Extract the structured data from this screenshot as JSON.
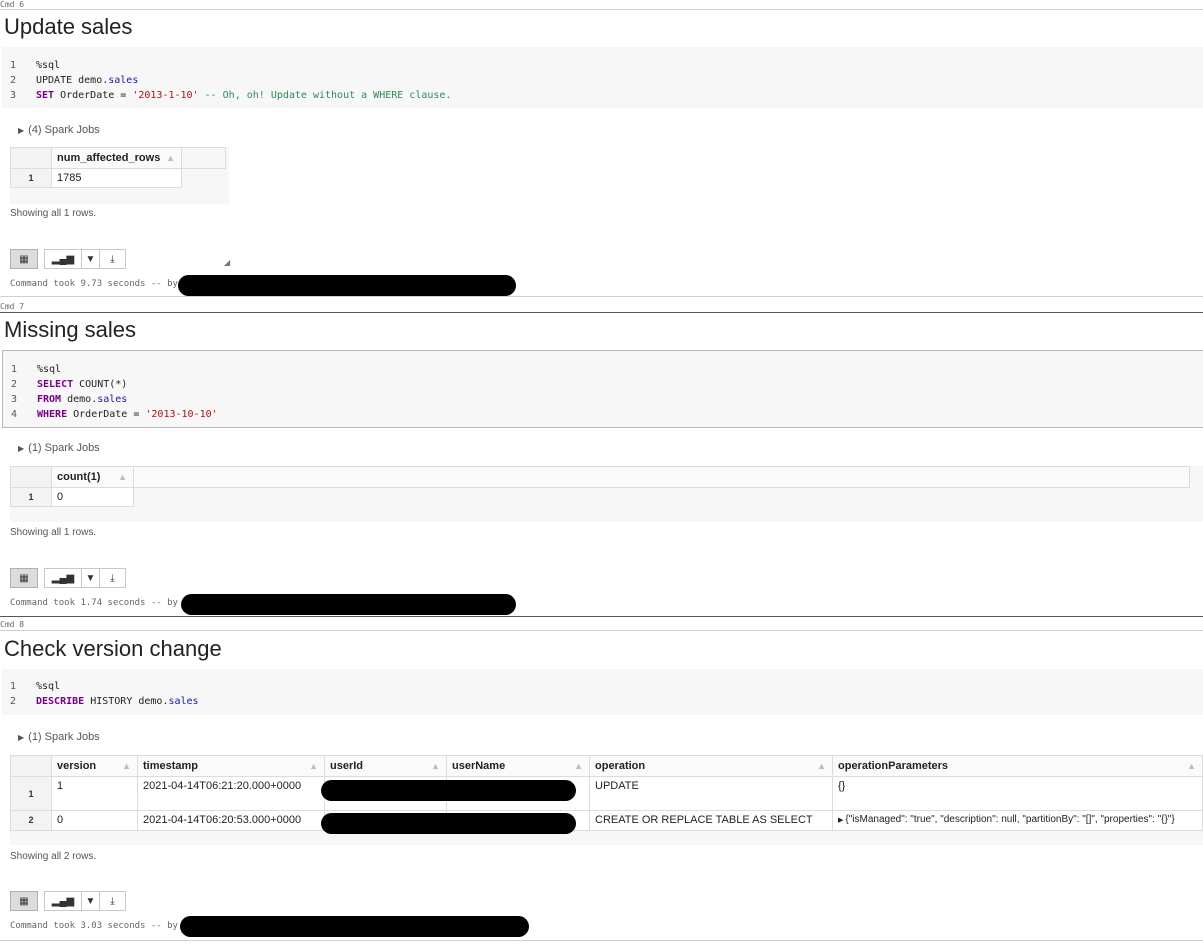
{
  "cells": [
    {
      "cmd": "Cmd 6",
      "title": "Update sales",
      "code": [
        {
          "n": "1",
          "tokens": [
            {
              "t": "%sql",
              "c": ""
            }
          ]
        },
        {
          "n": "2",
          "tokens": [
            {
              "t": "UPDATE demo.",
              "c": ""
            },
            {
              "t": "sales",
              "c": "tb"
            }
          ]
        },
        {
          "n": "3",
          "tokens": [
            {
              "t": "SET",
              "c": "kw"
            },
            {
              "t": " OrderDate = ",
              "c": ""
            },
            {
              "t": "'2013-1-10'",
              "c": "str"
            },
            {
              "t": " -- Oh, oh! Update without a WHERE clause.",
              "c": "cmt"
            }
          ]
        }
      ],
      "jobs": "(4) Spark Jobs",
      "table": {
        "headers": [
          "num_affected_rows"
        ],
        "rows": [
          {
            "rn": "1",
            "cells": [
              "1785"
            ]
          }
        ]
      },
      "showing": "Showing all 1 rows.",
      "took": "Command took 9.73 seconds -- by"
    },
    {
      "cmd": "Cmd 7",
      "title": "Missing sales",
      "code": [
        {
          "n": "1",
          "tokens": [
            {
              "t": "%sql",
              "c": ""
            }
          ]
        },
        {
          "n": "2",
          "tokens": [
            {
              "t": "SELECT",
              "c": "kw"
            },
            {
              "t": " COUNT(*)",
              "c": ""
            }
          ]
        },
        {
          "n": "3",
          "tokens": [
            {
              "t": "FROM",
              "c": "kw"
            },
            {
              "t": " demo.",
              "c": ""
            },
            {
              "t": "sales",
              "c": "tb"
            }
          ]
        },
        {
          "n": "4",
          "tokens": [
            {
              "t": "WHERE",
              "c": "kw"
            },
            {
              "t": " OrderDate = ",
              "c": ""
            },
            {
              "t": "'2013-10-10'",
              "c": "str"
            }
          ]
        }
      ],
      "jobs": "(1) Spark Jobs",
      "table": {
        "headers": [
          "count(1)"
        ],
        "rows": [
          {
            "rn": "1",
            "cells": [
              "0"
            ]
          }
        ]
      },
      "showing": "Showing all 1 rows.",
      "took": "Command took 1.74 seconds -- by"
    },
    {
      "cmd": "Cmd 8",
      "title": "Check version change",
      "code": [
        {
          "n": "1",
          "tokens": [
            {
              "t": "%sql",
              "c": ""
            }
          ]
        },
        {
          "n": "2",
          "tokens": [
            {
              "t": "DESCRIBE",
              "c": "kw"
            },
            {
              "t": " HISTORY demo.",
              "c": ""
            },
            {
              "t": "sales",
              "c": "tb"
            }
          ]
        }
      ],
      "jobs": "(1) Spark Jobs",
      "table": {
        "headers": [
          "version",
          "timestamp",
          "userId",
          "userName",
          "operation",
          "operationParameters"
        ],
        "rows": [
          {
            "rn": "1",
            "cells": [
              "1",
              "2021-04-14T06:21:20.000+0000",
              "",
              "",
              "UPDATE",
              "{}"
            ]
          },
          {
            "rn": "2",
            "cells": [
              "0",
              "2021-04-14T06:20:53.000+0000",
              "",
              "",
              "CREATE OR REPLACE TABLE AS SELECT",
              "{\"isManaged\": \"true\", \"description\": null, \"partitionBy\": \"[]\", \"properties\": \"{}\"}"
            ]
          }
        ]
      },
      "showing": "Showing all 2 rows.",
      "took": "Command took 3.03 seconds -- by"
    }
  ],
  "icons": {
    "table_view": "table-icon",
    "chart_view": "bar-chart-icon",
    "dropdown": "chevron-down-icon",
    "download": "download-icon",
    "expand": "triangle-right-icon"
  }
}
